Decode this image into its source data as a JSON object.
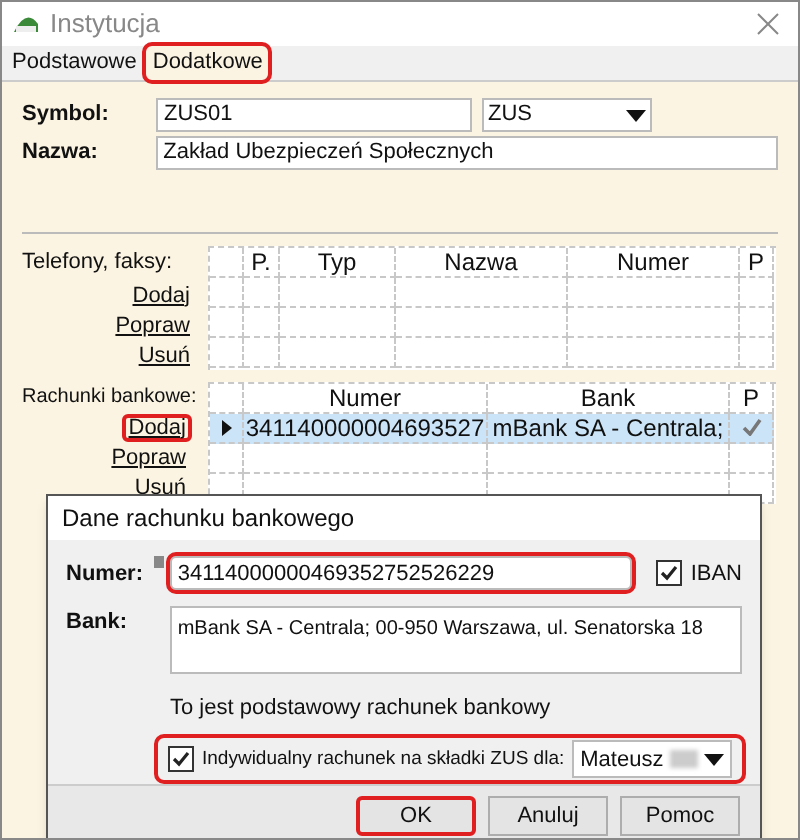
{
  "window": {
    "title": "Instytucja"
  },
  "tabs": [
    {
      "label": "Podstawowe",
      "selected": false,
      "highlighted": false
    },
    {
      "label": "Dodatkowe",
      "selected": true,
      "highlighted": true
    }
  ],
  "symbol": {
    "label": "Symbol:",
    "value": "ZUS01",
    "type": "ZUS"
  },
  "name": {
    "label": "Nazwa:",
    "value": "Zakład Ubezpieczeń Społecznych"
  },
  "phones": {
    "label": "Telefony, faksy:",
    "links": [
      {
        "label": "Dodaj",
        "highlighted": false
      },
      {
        "label": "Popraw",
        "highlighted": false
      },
      {
        "label": "Usuń",
        "highlighted": false
      }
    ],
    "columns": [
      "P.",
      "Typ",
      "Nazwa",
      "Numer",
      "P"
    ]
  },
  "accounts": {
    "label": "Rachunki bankowe:",
    "links": [
      {
        "label": "Dodaj",
        "highlighted": true
      },
      {
        "label": "Popraw",
        "highlighted": false
      },
      {
        "label": "Usuń",
        "highlighted": false
      }
    ],
    "columns": [
      "Numer",
      "Bank",
      "P"
    ],
    "rows": [
      {
        "number": "341140000004693527",
        "bank": "mBank SA  - Centrala;",
        "primary": true,
        "selected": true
      }
    ]
  },
  "dialog": {
    "title": "Dane rachunku bankowego",
    "number": {
      "label": "Numer:",
      "value": "34114000000469352752526229",
      "highlighted": true
    },
    "iban": {
      "label": "IBAN",
      "checked": true
    },
    "bank": {
      "label": "Bank:",
      "value": "mBank SA  - Centrala; 00-950 Warszawa, ul. Senatorska 18"
    },
    "primary_text": "To jest podstawowy rachunek bankowy",
    "individual": {
      "label": "Indywidualny rachunek na składki ZUS dla:",
      "checked": true,
      "person": "Mateusz",
      "highlighted": true
    },
    "buttons": [
      {
        "label": "OK",
        "highlighted": true
      },
      {
        "label": "Anuluj",
        "highlighted": false
      },
      {
        "label": "Pomoc",
        "highlighted": false
      }
    ]
  }
}
